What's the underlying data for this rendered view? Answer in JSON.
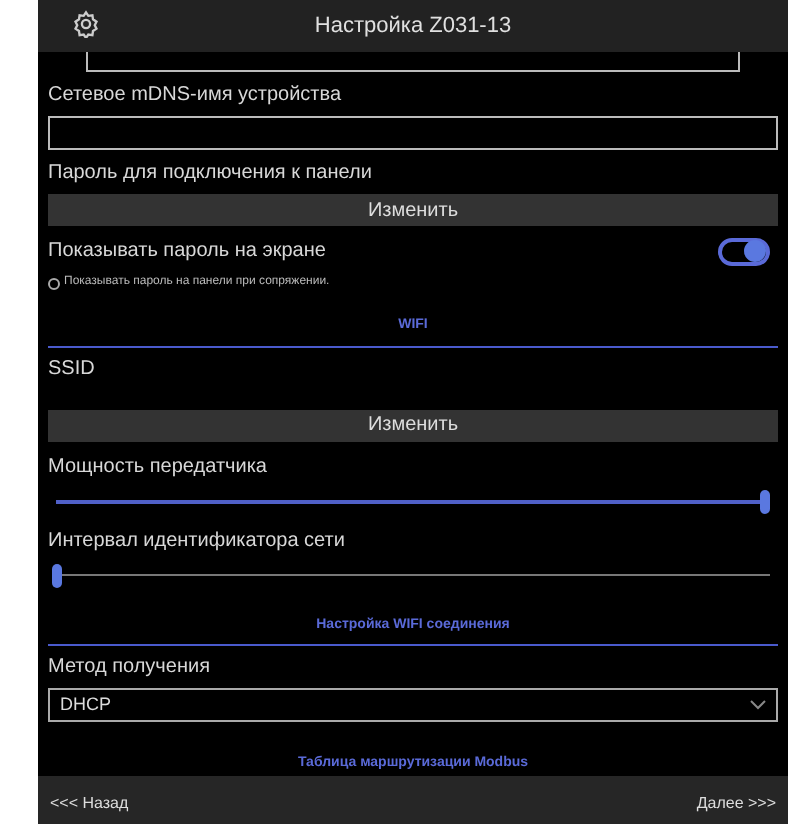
{
  "header": {
    "title": "Настройка Z031-13"
  },
  "mdns": {
    "label": "Сетевое mDNS-имя устройства"
  },
  "password": {
    "label": "Пароль для подключения к панели",
    "button": "Изменить"
  },
  "show_password": {
    "label": "Показывать пароль на экране",
    "on": true,
    "hint": "Показывать пароль на панели при сопряжении.",
    "hint_checked": false
  },
  "wifi": {
    "heading": "WIFI",
    "ssid_label": "SSID",
    "button": "Изменить",
    "sliders": [
      {
        "label": "Мощность передатчика",
        "level": 1
      },
      {
        "label": "Интервал идентификатора сети",
        "level": 0
      }
    ]
  },
  "connection": {
    "heading": "Настройка WIFI соединения",
    "method_label": "Метод получения",
    "method_value": "DHCP"
  },
  "modbus_link": "Таблица маршрутизации Modbus",
  "footer": {
    "back": "<<< Назад",
    "next": "Далее >>>"
  }
}
